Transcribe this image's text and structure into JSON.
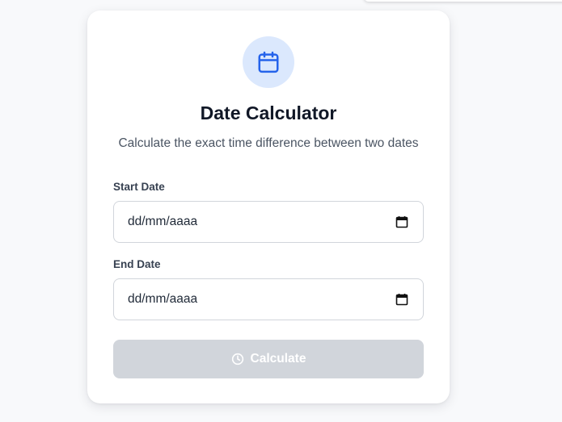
{
  "card": {
    "title": "Date Calculator",
    "subtitle": "Calculate the exact time difference between two dates",
    "icon": "calendar-icon"
  },
  "form": {
    "start_label": "Start Date",
    "start_value": "dd/mm/aaaa",
    "end_label": "End Date",
    "end_value": "dd/mm/aaaa",
    "calculate_label": "Calculate",
    "calculate_icon": "clock-icon",
    "calculate_disabled": true
  },
  "colors": {
    "accent": "#2563eb",
    "icon_bg": "#dbe8fd",
    "button_disabled": "#d1d5db",
    "title": "#111827",
    "subtitle": "#4b5563"
  }
}
